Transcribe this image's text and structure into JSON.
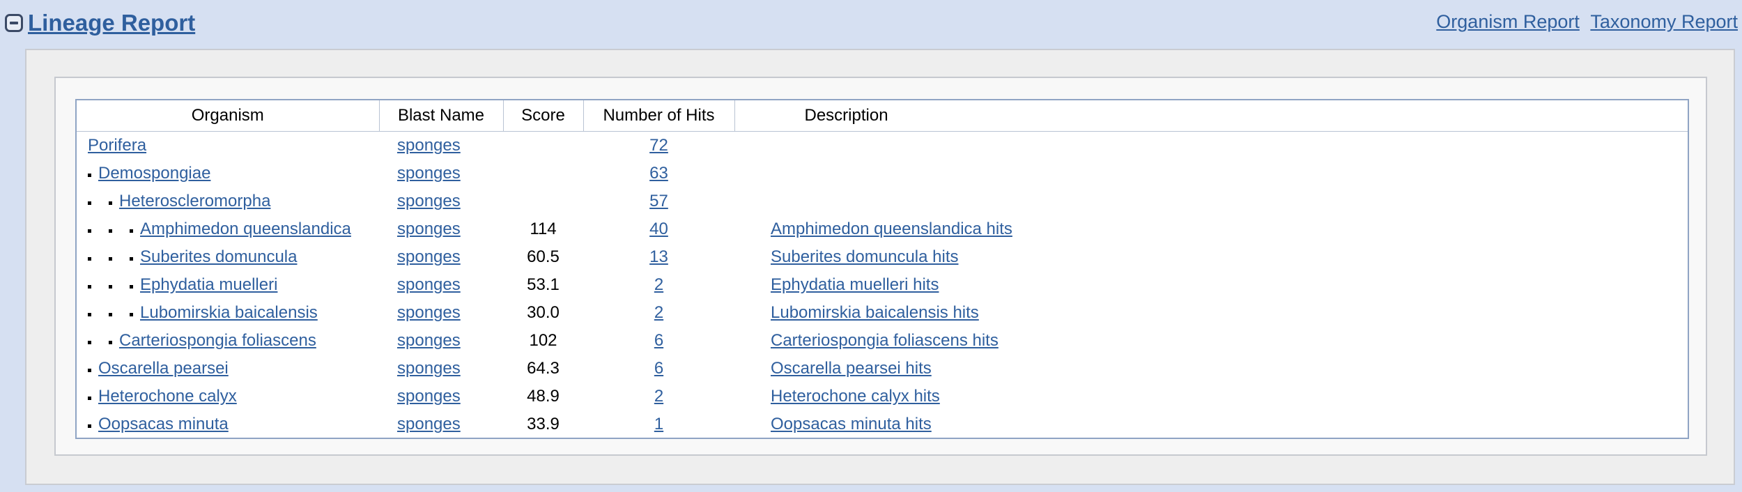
{
  "header": {
    "title": "Lineage Report",
    "links": [
      "Organism Report",
      "Taxonomy Report"
    ]
  },
  "table": {
    "columns": [
      "Organism",
      "Blast Name",
      "Score",
      "Number of Hits",
      "Description"
    ],
    "rows": [
      {
        "level": 0,
        "organism": "Porifera",
        "blast_name": "sponges",
        "score": "",
        "hits": "72",
        "description": ""
      },
      {
        "level": 1,
        "organism": "Demospongiae",
        "blast_name": "sponges",
        "score": "",
        "hits": "63",
        "description": ""
      },
      {
        "level": 2,
        "organism": "Heteroscleromorpha",
        "blast_name": "sponges",
        "score": "",
        "hits": "57",
        "description": ""
      },
      {
        "level": 3,
        "organism": "Amphimedon queenslandica",
        "blast_name": "sponges",
        "score": "114",
        "hits": "40",
        "description": "Amphimedon queenslandica hits"
      },
      {
        "level": 3,
        "organism": "Suberites domuncula",
        "blast_name": "sponges",
        "score": "60.5",
        "hits": "13",
        "description": "Suberites domuncula hits"
      },
      {
        "level": 3,
        "organism": "Ephydatia muelleri",
        "blast_name": "sponges",
        "score": "53.1",
        "hits": "2",
        "description": "Ephydatia muelleri hits"
      },
      {
        "level": 3,
        "organism": "Lubomirskia baicalensis",
        "blast_name": "sponges",
        "score": "30.0",
        "hits": "2",
        "description": "Lubomirskia baicalensis hits"
      },
      {
        "level": 2,
        "organism": "Carteriospongia foliascens",
        "blast_name": "sponges",
        "score": "102",
        "hits": "6",
        "description": "Carteriospongia foliascens hits"
      },
      {
        "level": 1,
        "organism": "Oscarella pearsei",
        "blast_name": "sponges",
        "score": "64.3",
        "hits": "6",
        "description": "Oscarella pearsei hits"
      },
      {
        "level": 1,
        "organism": "Heterochone calyx",
        "blast_name": "sponges",
        "score": "48.9",
        "hits": "2",
        "description": "Heterochone calyx hits"
      },
      {
        "level": 1,
        "organism": "Oopsacas minuta",
        "blast_name": "sponges",
        "score": "33.9",
        "hits": "1",
        "description": "Oopsacas minuta hits"
      }
    ]
  },
  "colors": {
    "page_background": "#d6e0f2",
    "link": "#2f5f9e",
    "table_border": "#8fa4c4"
  }
}
